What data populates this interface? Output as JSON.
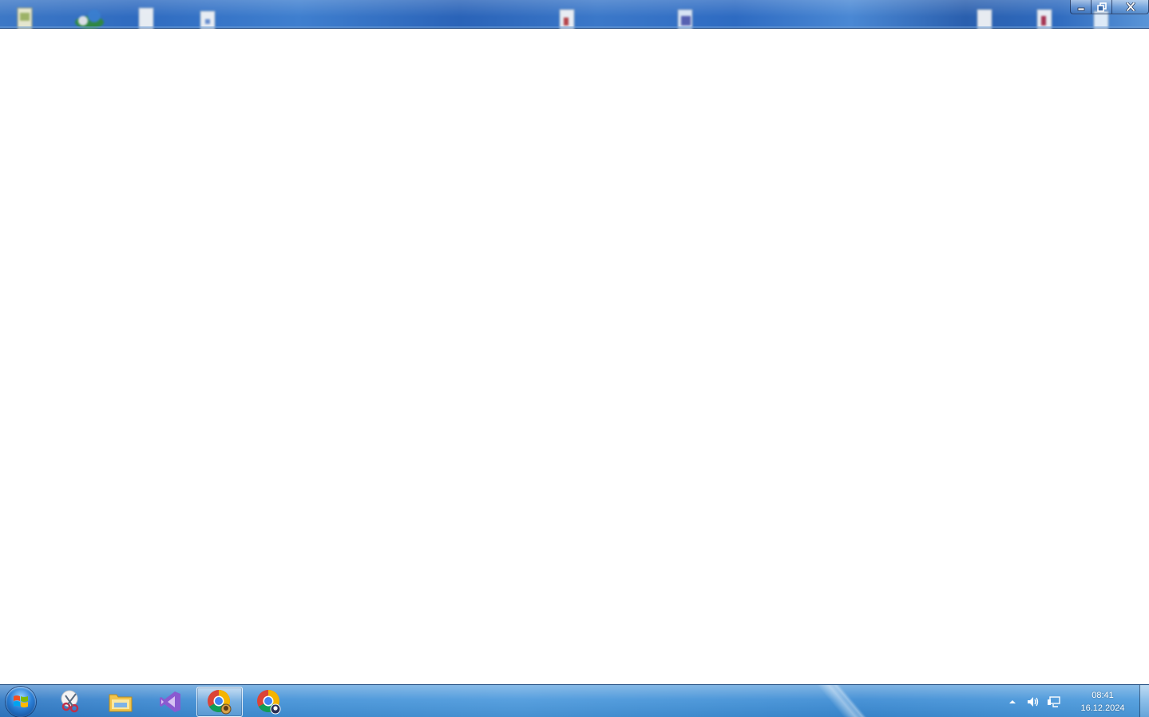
{
  "window": {
    "controls": {
      "minimize_icon": "minimize-icon",
      "maximize_icon": "restore-icon",
      "close_icon": "close-icon"
    }
  },
  "desktop_icons": [
    {
      "icon": "file-icon"
    },
    {
      "icon": "network-icon"
    },
    {
      "icon": "document-icon"
    },
    {
      "icon": "document-icon"
    },
    {
      "icon": "pdf-document-icon"
    },
    {
      "icon": "image-document-icon"
    },
    {
      "icon": "document-icon"
    },
    {
      "icon": "pdf-document-icon"
    },
    {
      "icon": "document-icon"
    }
  ],
  "taskbar": {
    "start_button": {
      "icon": "windows-logo-icon"
    },
    "pinned": [
      {
        "name": "snipping-tool",
        "icon": "scissors-icon",
        "active": false
      },
      {
        "name": "windows-explorer",
        "icon": "folder-icon",
        "active": false
      },
      {
        "name": "visual-studio",
        "icon": "visual-studio-icon",
        "active": false
      },
      {
        "name": "chrome-profile-1",
        "icon": "chrome-icon",
        "active": true
      },
      {
        "name": "chrome-profile-2",
        "icon": "chrome-icon",
        "active": false
      }
    ],
    "tray": {
      "icons": [
        "show-hidden-icons-arrow",
        "volume-icon",
        "network-icon"
      ],
      "time": "08:41",
      "date": "16.12.2024"
    }
  },
  "colors": {
    "titlebar_blue": "#2f6bc0",
    "taskbar_blue": "#3f8fd6",
    "client_background": "#ffffff"
  }
}
